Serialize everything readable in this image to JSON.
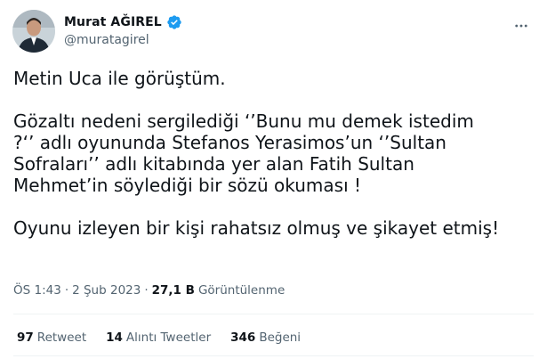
{
  "author": {
    "display_name": "Murat AĞIREL",
    "handle": "@muratagirel",
    "verified": true,
    "verified_color": "#1d9bf0"
  },
  "tweet": {
    "lines": [
      "Metin Uca ile görüştüm.",
      "",
      "Gözaltı nedeni sergilediği ‘’Bunu mu demek istedim",
      "?‘’ adlı oyununda Stefanos Yerasimos’un ‘’Sultan",
      "Sofraları’’ adlı kitabında yer alan Fatih Sultan",
      "Mehmet’in söylediği bir sözü okuması !",
      "",
      "Oyunu izleyen bir kişi rahatsız olmuş ve şikayet etmiş!"
    ]
  },
  "meta": {
    "time": "ÖS 1:43",
    "separator": "·",
    "date": "2 Şub 2023",
    "views_count": "27,1 B",
    "views_label": "Görüntülenme"
  },
  "stats": {
    "retweets_count": "97",
    "retweets_label": "Retweet",
    "quotes_count": "14",
    "quotes_label": "Alıntı Tweetler",
    "likes_count": "346",
    "likes_label": "Beğeni"
  },
  "icons": {
    "more": "more-horizontal-icon",
    "verified": "verified-badge-icon"
  }
}
